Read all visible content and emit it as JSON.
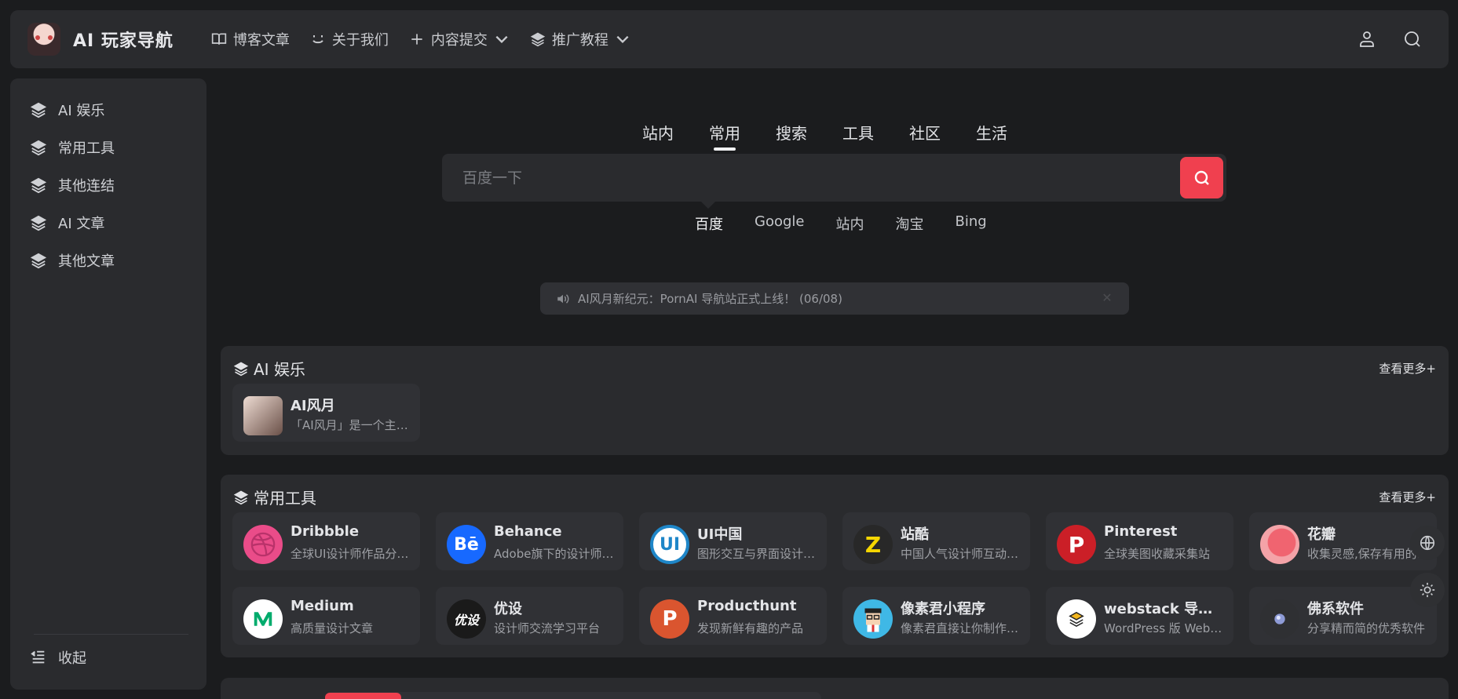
{
  "header": {
    "logo_text": "AI 玩家导航",
    "nav": [
      {
        "label": "博客文章",
        "icon": "book-icon",
        "dropdown": false
      },
      {
        "label": "关于我们",
        "icon": "smile-icon",
        "dropdown": false
      },
      {
        "label": "内容提交",
        "icon": "plus-icon",
        "dropdown": true
      },
      {
        "label": "推广教程",
        "icon": "layers-icon",
        "dropdown": true
      }
    ]
  },
  "sidebar": {
    "items": [
      {
        "label": "AI 娱乐",
        "icon": "layers-icon"
      },
      {
        "label": "常用工具",
        "icon": "layers-icon"
      },
      {
        "label": "其他连结",
        "icon": "layers-icon"
      },
      {
        "label": "AI 文章",
        "icon": "layers-icon"
      },
      {
        "label": "其他文章",
        "icon": "layers-icon"
      }
    ],
    "collapse_label": "收起"
  },
  "search": {
    "tabs": [
      "站内",
      "常用",
      "搜索",
      "工具",
      "社区",
      "生活"
    ],
    "active_tab": "常用",
    "placeholder": "百度一下",
    "engines": [
      "百度",
      "Google",
      "站内",
      "淘宝",
      "Bing"
    ],
    "active_engine": "百度",
    "accent_color": "#f0404f"
  },
  "notice": {
    "text": "AI风月新纪元：PornAI 导航站正式上线！ (06/08)"
  },
  "sections": [
    {
      "title": "AI 娱乐",
      "more": "查看更多+",
      "cards": [
        {
          "title": "AI风月",
          "desc": "「AI风月」是一个主题丰富的AI娱乐站",
          "icon_color": "#d9c2b8",
          "icon_text": ""
        }
      ]
    },
    {
      "title": "常用工具",
      "more": "查看更多+",
      "cards": [
        {
          "title": "Dribbble",
          "desc": "全球UI设计师作品分享平台",
          "icon_color": "#ea4c89",
          "icon_text": ""
        },
        {
          "title": "Behance",
          "desc": "Adobe旗下的设计师交流平台",
          "icon_color": "#1769ff",
          "icon_text": "Bē"
        },
        {
          "title": "UI中国",
          "desc": "图形交互与界面设计交流平台",
          "icon_color": "#1e86c8",
          "icon_text": "UI"
        },
        {
          "title": "站酷",
          "desc": "中国人气设计师互动平台",
          "icon_color": "#282828",
          "icon_text": "Z"
        },
        {
          "title": "Pinterest",
          "desc": "全球美图收藏采集站",
          "icon_color": "#cb1f27",
          "icon_text": "P"
        },
        {
          "title": "花瓣",
          "desc": "收集灵感,保存有用的素材",
          "icon_color": "#e8575d",
          "icon_text": ""
        },
        {
          "title": "Medium",
          "desc": "高质量设计文章",
          "icon_color": "#ffffff",
          "icon_text": ""
        },
        {
          "title": "优设",
          "desc": "设计师交流学习平台",
          "icon_color": "#1a1a1a",
          "icon_text": "优设"
        },
        {
          "title": "Producthunt",
          "desc": "发现新鲜有趣的产品",
          "icon_color": "#da552f",
          "icon_text": "P"
        },
        {
          "title": "像素君小程序",
          "desc": "像素君直接让你制作像素画",
          "icon_color": "#3fb8e6",
          "icon_text": ""
        },
        {
          "title": "webstack 导航主题",
          "desc": "WordPress 版 WebStack 导航主题",
          "icon_color": "#ffffff",
          "icon_text": ""
        },
        {
          "title": "佛系软件",
          "desc": "分享精而简的优秀软件",
          "icon_color": "#2f3033",
          "icon_text": ""
        }
      ]
    }
  ]
}
